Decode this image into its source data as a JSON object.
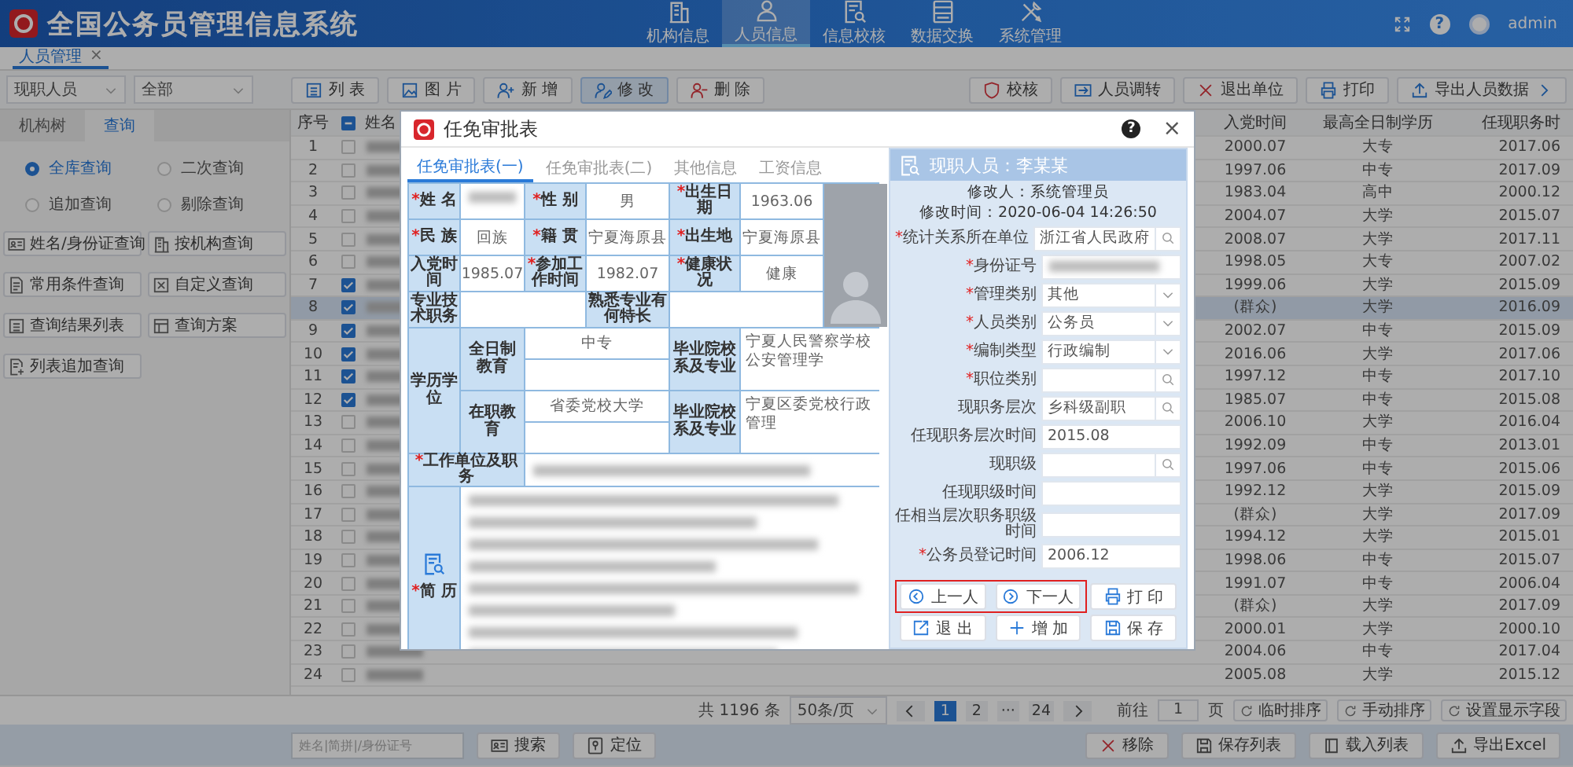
{
  "header": {
    "title": "全国公务员管理信息系统",
    "nav": [
      {
        "label": "机构信息",
        "kind": "building",
        "selected": false
      },
      {
        "label": "人员信息",
        "kind": "person",
        "selected": true
      },
      {
        "label": "信息校核",
        "kind": "docsearch",
        "selected": false
      },
      {
        "label": "数据交换",
        "kind": "server",
        "selected": false
      },
      {
        "label": "系统管理",
        "kind": "tools",
        "selected": false
      }
    ],
    "help": "?",
    "user": "admin"
  },
  "page_tabs": [
    {
      "label": "人员管理",
      "close": "×",
      "selected": true
    }
  ],
  "toolbar": {
    "selects": [
      "现职人员",
      "全部"
    ],
    "left_buttons": [
      {
        "label": "列 表",
        "kind": "list",
        "selected": false
      },
      {
        "label": "图 片",
        "kind": "picture",
        "selected": false
      },
      {
        "label": "新 增",
        "kind": "personadd",
        "selected": false
      },
      {
        "label": "修 改",
        "kind": "personedit",
        "selected": true
      },
      {
        "label": "删 除",
        "kind": "personremove",
        "selected": false
      }
    ],
    "right_buttons": [
      {
        "label": "校核",
        "kind": "shield"
      },
      {
        "label": "人员调转",
        "kind": "transfer"
      },
      {
        "label": "退出单位",
        "kind": "close"
      },
      {
        "label": "打印",
        "kind": "printer"
      },
      {
        "label": "导出人员数据",
        "kind": "upload"
      }
    ]
  },
  "left_panel": {
    "tabs": [
      {
        "label": "机构树",
        "selected": false
      },
      {
        "label": "查询",
        "selected": true
      }
    ],
    "radios": [
      {
        "label": "全库查询",
        "selected": true
      },
      {
        "label": "二次查询",
        "selected": false
      },
      {
        "label": "追加查询",
        "selected": false
      },
      {
        "label": "剔除查询",
        "selected": false
      }
    ],
    "buttons": [
      {
        "label": "姓名/身份证查询",
        "kind": "idcard"
      },
      {
        "label": "按机构查询",
        "kind": "building"
      },
      {
        "label": "常用条件查询",
        "kind": "document"
      },
      {
        "label": "自定义查询",
        "kind": "form"
      },
      {
        "label": "查询结果列表",
        "kind": "list"
      },
      {
        "label": "查询方案",
        "kind": "grid"
      },
      {
        "label": "列表追加查询",
        "kind": "docplus"
      }
    ]
  },
  "table": {
    "columns": [
      "序号",
      "姓名",
      "入党时间",
      "最高全日制学历",
      "任现职务时"
    ],
    "header_checkbox_partial": true,
    "rows": [
      {
        "seq": "1",
        "checked": false,
        "selected": false,
        "join": "2000.07",
        "edu": "大专",
        "since": "2017.06"
      },
      {
        "seq": "2",
        "checked": false,
        "selected": false,
        "join": "1997.06",
        "edu": "中专",
        "since": "2017.09"
      },
      {
        "seq": "3",
        "checked": false,
        "selected": false,
        "join": "1983.04",
        "edu": "高中",
        "since": "2000.12"
      },
      {
        "seq": "4",
        "checked": false,
        "selected": false,
        "join": "2004.07",
        "edu": "大学",
        "since": "2015.07"
      },
      {
        "seq": "5",
        "checked": false,
        "selected": false,
        "join": "2008.07",
        "edu": "大学",
        "since": "2017.11"
      },
      {
        "seq": "6",
        "checked": false,
        "selected": false,
        "join": "1998.05",
        "edu": "大专",
        "since": "2007.02"
      },
      {
        "seq": "7",
        "checked": true,
        "selected": false,
        "join": "1999.06",
        "edu": "大学",
        "since": "2015.09"
      },
      {
        "seq": "8",
        "checked": true,
        "selected": true,
        "join": "(群众)",
        "edu": "大学",
        "since": "2016.09"
      },
      {
        "seq": "9",
        "checked": true,
        "selected": false,
        "join": "2002.07",
        "edu": "中专",
        "since": "2015.09"
      },
      {
        "seq": "10",
        "checked": true,
        "selected": false,
        "join": "2016.06",
        "edu": "大学",
        "since": "2017.06"
      },
      {
        "seq": "11",
        "checked": true,
        "selected": false,
        "join": "1997.12",
        "edu": "中专",
        "since": "2017.10"
      },
      {
        "seq": "12",
        "checked": true,
        "selected": false,
        "join": "1985.07",
        "edu": "中专",
        "since": "2015.08"
      },
      {
        "seq": "13",
        "checked": false,
        "selected": false,
        "join": "2006.10",
        "edu": "大学",
        "since": "2016.04"
      },
      {
        "seq": "14",
        "checked": false,
        "selected": false,
        "join": "1992.09",
        "edu": "中专",
        "since": "2013.01"
      },
      {
        "seq": "15",
        "checked": false,
        "selected": false,
        "join": "1997.06",
        "edu": "中专",
        "since": "2015.06"
      },
      {
        "seq": "16",
        "checked": false,
        "selected": false,
        "join": "1992.12",
        "edu": "大学",
        "since": "2015.09"
      },
      {
        "seq": "17",
        "checked": false,
        "selected": false,
        "join": "(群众)",
        "edu": "大学",
        "since": "2017.09"
      },
      {
        "seq": "18",
        "checked": false,
        "selected": false,
        "join": "1994.12",
        "edu": "大学",
        "since": "2015.01"
      },
      {
        "seq": "19",
        "checked": false,
        "selected": false,
        "join": "1998.06",
        "edu": "中专",
        "since": "2015.07"
      },
      {
        "seq": "20",
        "checked": false,
        "selected": false,
        "join": "1991.07",
        "edu": "中专",
        "since": "2006.04"
      },
      {
        "seq": "21",
        "checked": false,
        "selected": false,
        "join": "(群众)",
        "edu": "大学",
        "since": "2017.09"
      },
      {
        "seq": "22",
        "checked": false,
        "selected": false,
        "join": "2000.01",
        "edu": "大学",
        "since": "2000.10"
      },
      {
        "seq": "23",
        "checked": false,
        "selected": false,
        "join": "2004.06",
        "edu": "中专",
        "since": "2017.04"
      },
      {
        "seq": "24",
        "checked": false,
        "selected": false,
        "join": "2005.08",
        "edu": "大学",
        "since": "2015.12"
      }
    ]
  },
  "pager": {
    "total": "共 1196 条",
    "page_size": "50条/页",
    "pages": [
      {
        "label": "1",
        "selected": true
      },
      {
        "label": "2",
        "selected": false
      },
      {
        "label": "···",
        "selected": false
      },
      {
        "label": "24",
        "selected": false
      }
    ],
    "goto_label": "前往",
    "goto_value": "1",
    "goto_unit": "页",
    "buttons": [
      "临时排序",
      "手动排序",
      "设置显示字段"
    ]
  },
  "bottom_bar": {
    "search_placeholder": "姓名|简拼|/身份证号",
    "left_buttons": [
      {
        "label": "搜索",
        "kind": "idcard"
      },
      {
        "label": "定位",
        "kind": "pin"
      }
    ],
    "right_buttons": [
      {
        "label": "移除",
        "kind": "close"
      },
      {
        "label": "保存列表",
        "kind": "save"
      },
      {
        "label": "载入列表",
        "kind": "book"
      },
      {
        "label": "导出Excel",
        "kind": "upload"
      }
    ]
  },
  "modal": {
    "title": "任免审批表",
    "help": "?",
    "close": "×",
    "tabs": [
      {
        "label": "任免审批表(一)",
        "selected": true
      },
      {
        "label": "任免审批表(二)",
        "selected": false
      },
      {
        "label": "其他信息",
        "selected": false
      },
      {
        "label": "工资信息",
        "selected": false
      }
    ],
    "basic_rows": [
      [
        {
          "mark": "*",
          "label": "姓 名",
          "blurred": true
        },
        {
          "mark": "*",
          "label": "性 别",
          "value": "男"
        },
        {
          "mark": "*",
          "label": "出生日期",
          "value": "1963.06"
        }
      ],
      [
        {
          "mark": "*",
          "label": "民 族",
          "value": "回族"
        },
        {
          "mark": "*",
          "label": "籍 贯",
          "value": "宁夏海原县"
        },
        {
          "mark": "*",
          "label": "出生地",
          "value": "宁夏海原县"
        }
      ],
      [
        {
          "label": "入党时间",
          "value": "1985.07"
        },
        {
          "mark": "*",
          "label": "参加工作时间",
          "value": "1982.07"
        },
        {
          "mark": "*",
          "label": "健康状况",
          "value": "健康"
        }
      ]
    ],
    "specialty": [
      {
        "label": "专业技术职务"
      },
      {
        "label": "熟悉专业有何特长"
      }
    ],
    "education_label": "学历学位",
    "education": [
      {
        "label": "全日制教育",
        "degree": "中专",
        "school_label": "毕业院校系及专业",
        "school": "宁夏人民警察学校公安管理学"
      },
      {
        "label": "在职教育",
        "degree": "省委党校大学",
        "school_label": "毕业院校系及专业",
        "school": "宁夏区委党校行政管理"
      }
    ],
    "work": {
      "mark": "*",
      "label": "工作单位及职务"
    },
    "resume": {
      "mark": "*",
      "label": "简 历"
    },
    "side": {
      "title": "现职人员：李某某",
      "modifier": "修改人：系统管理员",
      "modified": "修改时间：2020-06-04 14:26:50",
      "fields": [
        {
          "mark": "*",
          "label": "统计关系所在单位",
          "value": "浙江省人民政府",
          "kind": "search"
        },
        {
          "mark": "*",
          "label": "身份证号",
          "kind": "blurred"
        },
        {
          "mark": "*",
          "label": "管理类别",
          "value": "其他",
          "kind": "select"
        },
        {
          "mark": "*",
          "label": "人员类别",
          "value": "公务员",
          "kind": "select"
        },
        {
          "mark": "*",
          "label": "编制类型",
          "value": "行政编制",
          "kind": "select"
        },
        {
          "mark": "*",
          "label": "职位类别",
          "kind": "search"
        },
        {
          "label": "现职务层次",
          "value": "乡科级副职",
          "kind": "search"
        },
        {
          "label": "任现职务层次时间",
          "value": "2015.08",
          "kind": "text"
        },
        {
          "label": "现职级",
          "kind": "search"
        },
        {
          "label": "任现职级时间",
          "kind": "text"
        },
        {
          "label": "任相当层次职务职级时间",
          "kind": "text"
        },
        {
          "mark": "*",
          "label": "公务员登记时间",
          "value": "2006.12",
          "kind": "text"
        }
      ],
      "nav_highlight": true,
      "buttons": [
        {
          "label": "上一人",
          "kind": "circleleft"
        },
        {
          "label": "下一人",
          "kind": "circleright"
        },
        {
          "label": "打 印",
          "kind": "printer"
        },
        {
          "label": "退 出",
          "kind": "exit"
        },
        {
          "label": "增 加",
          "kind": "plus"
        },
        {
          "label": "保 存",
          "kind": "save"
        }
      ]
    }
  }
}
